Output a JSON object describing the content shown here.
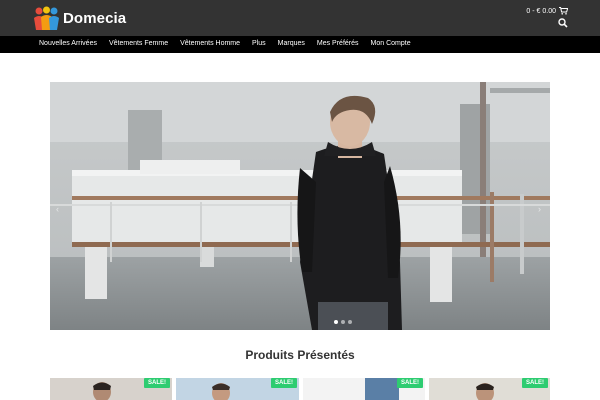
{
  "header": {
    "brand": "Domecia",
    "cart_text": "0 - € 0.00",
    "cart_icon": "cart-icon",
    "search_icon": "search-icon"
  },
  "nav": {
    "items": [
      "Nouvelles Arrivées",
      "Vêtements Femme",
      "Vêtements Homme",
      "Plus",
      "Marques",
      "Mes Préférés",
      "Mon Compte"
    ]
  },
  "slider": {
    "dots": 3,
    "active_dot": 0
  },
  "featured": {
    "title": "Produits Présentés",
    "products": [
      {
        "badge": "SALE!"
      },
      {
        "badge": "SALE!"
      },
      {
        "badge": "SALE!"
      },
      {
        "badge": "SALE!"
      }
    ]
  },
  "colors": {
    "header_bg": "#333333",
    "nav_bg": "#000000",
    "sale_badge": "#2ecc71"
  }
}
